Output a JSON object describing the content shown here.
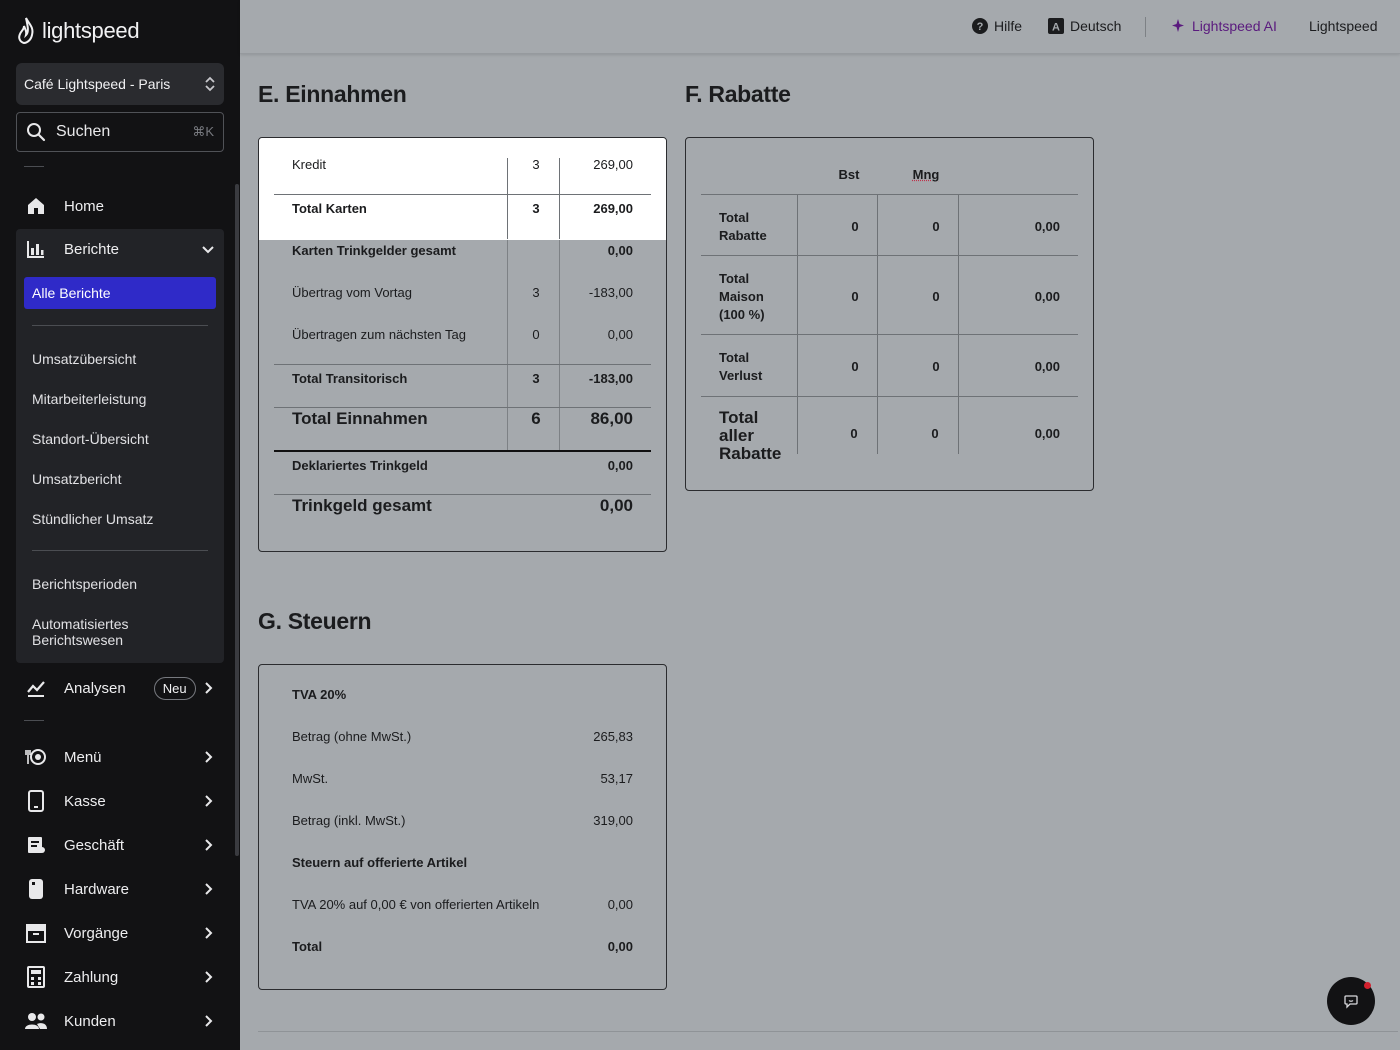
{
  "sidebar": {
    "logo": "lightspeed",
    "store": "Café Lightspeed - Paris",
    "search": {
      "label": "Suchen",
      "shortcut": "⌘K"
    },
    "nav": {
      "home": "Home",
      "reports": "Berichte",
      "all_reports": "Alle Berichte",
      "sub1": [
        "Umsatzübersicht",
        "Mitarbeiterleistung",
        "Standort-Übersicht",
        "Umsatzbericht",
        "Stündlicher Umsatz"
      ],
      "sub2": [
        "Berichtsperioden",
        "Automatisiertes Berichtswesen"
      ],
      "analytics": "Analysen",
      "analytics_badge": "Neu",
      "menu": "Menü",
      "register": "Kasse",
      "business": "Geschäft",
      "hardware": "Hardware",
      "transactions": "Vorgänge",
      "payment": "Zahlung",
      "customers": "Kunden"
    },
    "active_color": "#2f2ac8"
  },
  "topbar": {
    "help": "Hilfe",
    "language": "Deutsch",
    "ai": "Lightspeed AI",
    "account": "Lightspeed"
  },
  "income": {
    "title": "E. Einnahmen",
    "rows": {
      "credit": {
        "label": "Kredit",
        "count": "3",
        "amount": "269,00"
      },
      "total_cards": {
        "label": "Total Karten",
        "count": "3",
        "amount": "269,00"
      },
      "card_tips": {
        "label": "Karten Trinkgelder gesamt",
        "amount": "0,00"
      },
      "carry_prev": {
        "label": "Übertrag vom Vortag",
        "count": "3",
        "amount": "-183,00"
      },
      "carry_next": {
        "label": "Übertragen zum nächsten Tag",
        "count": "0",
        "amount": "0,00"
      },
      "total_transit": {
        "label": "Total Transitorisch",
        "count": "3",
        "amount": "-183,00"
      },
      "total_income": {
        "label": "Total Einnahmen",
        "count": "6",
        "amount": "86,00"
      },
      "declared_tip": {
        "label": "Deklariertes Trinkgeld",
        "amount": "0,00"
      },
      "tip_total": {
        "label": "Trinkgeld gesamt",
        "amount": "0,00"
      }
    }
  },
  "discounts": {
    "title": "F. Rabatte",
    "col_bst": "Bst",
    "col_mng": "Mng",
    "rows": [
      {
        "label": "Total Rabatte",
        "bst": "0",
        "mng": "0",
        "amount": "0,00"
      },
      {
        "label": "Total Maison (100 %)",
        "bst": "0",
        "mng": "0",
        "amount": "0,00"
      },
      {
        "label": "Total Verlust",
        "bst": "0",
        "mng": "0",
        "amount": "0,00"
      },
      {
        "label": "Total aller Rabatte",
        "bst": "0",
        "mng": "0",
        "amount": "0,00"
      }
    ]
  },
  "taxes": {
    "title": "G. Steuern",
    "rate_header": "TVA 20%",
    "net": {
      "label": "Betrag (ohne MwSt.)",
      "amount": "265,83"
    },
    "vat": {
      "label": "MwSt.",
      "amount": "53,17"
    },
    "gross": {
      "label": "Betrag (inkl. MwSt.)",
      "amount": "319,00"
    },
    "offered_header": "Steuern auf offerierte Artikel",
    "offered": {
      "label": "TVA 20% auf 0,00 € von offerierten Artikeln",
      "amount": "0,00"
    },
    "total": {
      "label": "Total",
      "amount": "0,00"
    }
  }
}
